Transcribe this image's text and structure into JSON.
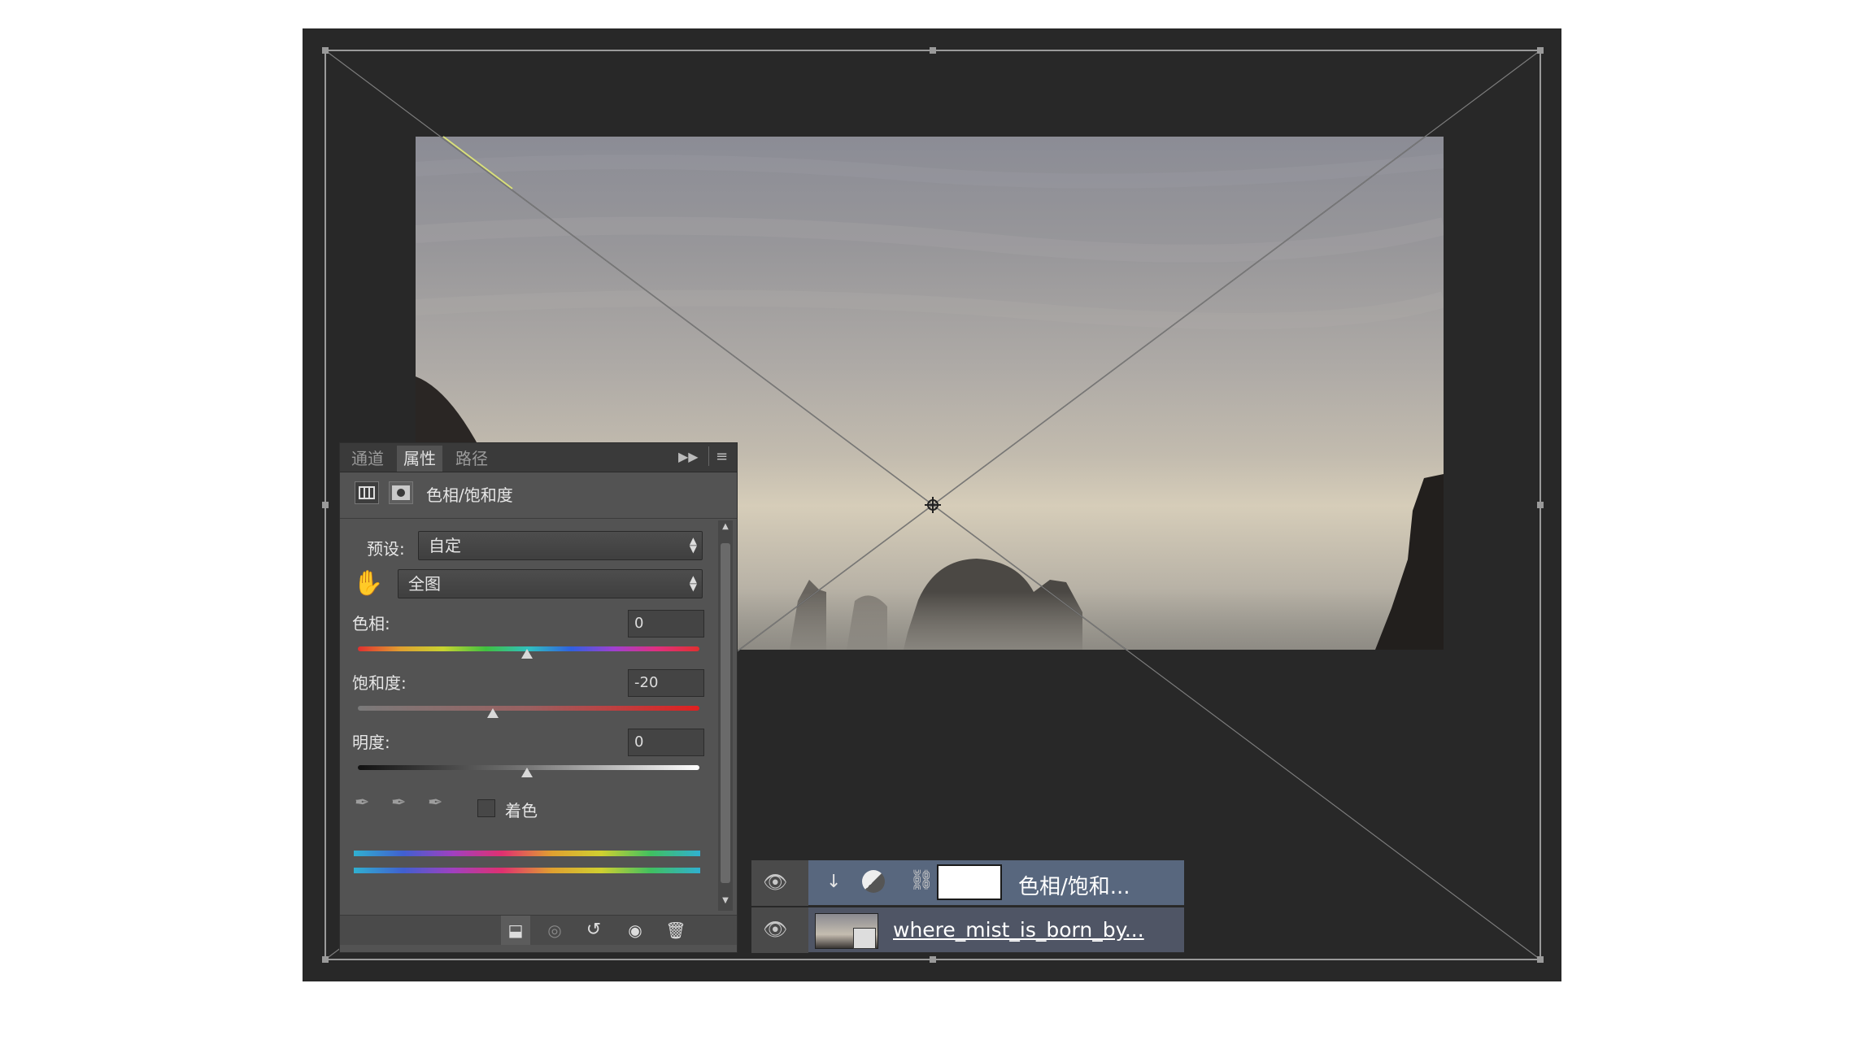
{
  "properties_panel": {
    "tabs": [
      "通道",
      "属性",
      "路径"
    ],
    "active_tab": "属性",
    "title": "色相/饱和度",
    "preset_label": "预设:",
    "preset_value": "自定",
    "channel_value": "全图",
    "hue_label": "色相:",
    "hue_value": "0",
    "saturation_label": "饱和度:",
    "saturation_value": "-20",
    "lightness_label": "明度:",
    "lightness_value": "0",
    "colorize_label": "着色"
  },
  "layers": [
    {
      "name": "色相/饱和...",
      "type": "adjustment"
    },
    {
      "name": "where_mist_is_born_by...",
      "type": "smart-object"
    }
  ],
  "icons": [
    "panel-menu-icon",
    "expand-panel-icon",
    "adjustment-icon",
    "mask-icon",
    "hand-target-icon",
    "eyedropper-icon",
    "eyedropper-plus-icon",
    "eyedropper-minus-icon",
    "clip-to-layer-icon",
    "view-previous-icon",
    "reset-icon",
    "visibility-icon",
    "trash-icon",
    "eye-icon",
    "link-icon"
  ]
}
